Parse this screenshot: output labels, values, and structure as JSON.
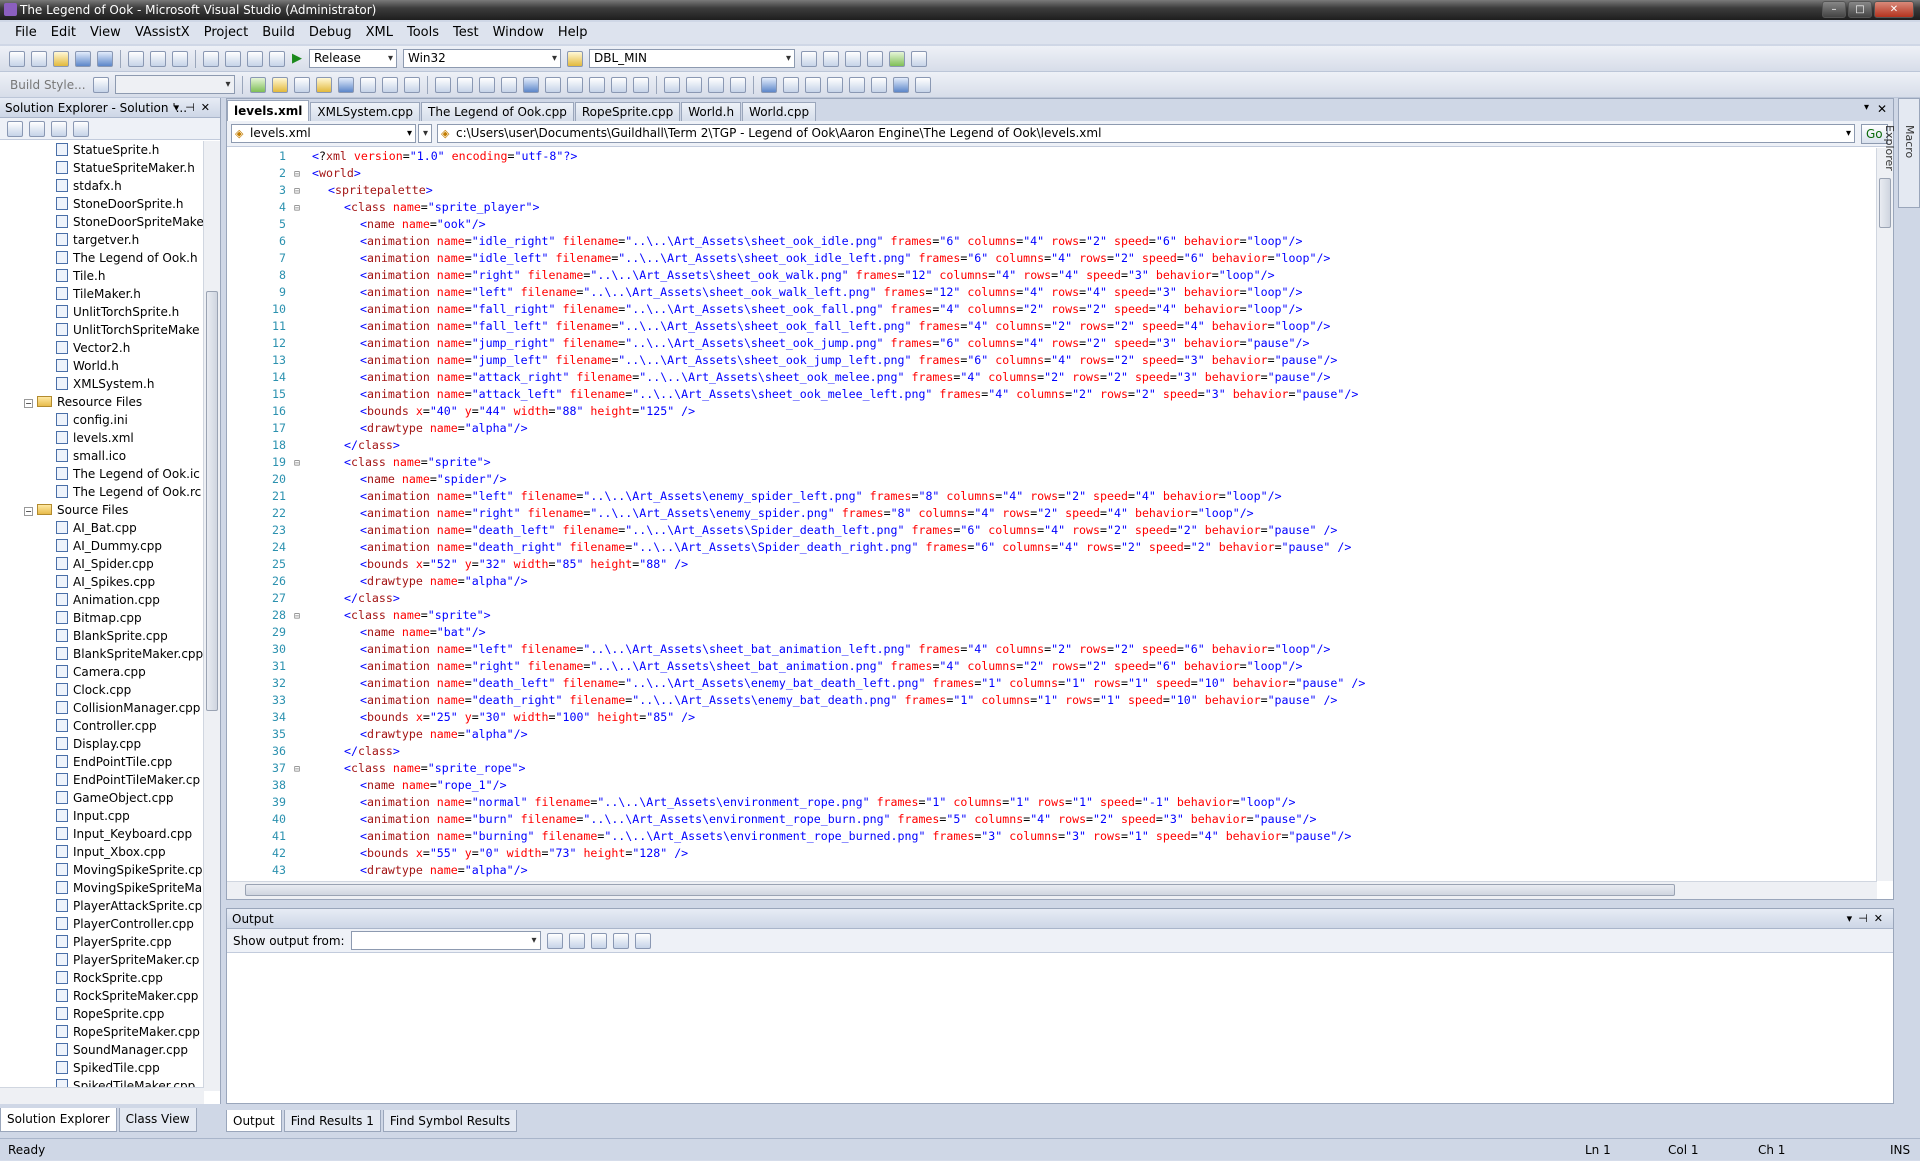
{
  "window": {
    "title": "The Legend of Ook - Microsoft Visual Studio (Administrator)"
  },
  "menu": [
    "File",
    "Edit",
    "View",
    "VAssistX",
    "Project",
    "Build",
    "Debug",
    "XML",
    "Tools",
    "Test",
    "Window",
    "Help"
  ],
  "toolbar": {
    "config": "Release",
    "platform": "Win32",
    "find_combo": "DBL_MIN",
    "build_style": "Build Style..."
  },
  "solution_explorer": {
    "title": "Solution Explorer - Solution '...",
    "items": [
      {
        "indent": 3,
        "type": "file",
        "label": "StatueSprite.h"
      },
      {
        "indent": 3,
        "type": "file",
        "label": "StatueSpriteMaker.h"
      },
      {
        "indent": 3,
        "type": "file",
        "label": "stdafx.h"
      },
      {
        "indent": 3,
        "type": "file",
        "label": "StoneDoorSprite.h"
      },
      {
        "indent": 3,
        "type": "file",
        "label": "StoneDoorSpriteMake"
      },
      {
        "indent": 3,
        "type": "file",
        "label": "targetver.h"
      },
      {
        "indent": 3,
        "type": "file",
        "label": "The Legend of Ook.h"
      },
      {
        "indent": 3,
        "type": "file",
        "label": "Tile.h"
      },
      {
        "indent": 3,
        "type": "file",
        "label": "TileMaker.h"
      },
      {
        "indent": 3,
        "type": "file",
        "label": "UnlitTorchSprite.h"
      },
      {
        "indent": 3,
        "type": "file",
        "label": "UnlitTorchSpriteMake"
      },
      {
        "indent": 3,
        "type": "file",
        "label": "Vector2.h"
      },
      {
        "indent": 3,
        "type": "file",
        "label": "World.h"
      },
      {
        "indent": 3,
        "type": "file",
        "label": "XMLSystem.h"
      },
      {
        "indent": 2,
        "type": "folder",
        "label": "Resource Files"
      },
      {
        "indent": 3,
        "type": "file",
        "label": "config.ini"
      },
      {
        "indent": 3,
        "type": "file",
        "label": "levels.xml"
      },
      {
        "indent": 3,
        "type": "file",
        "label": "small.ico"
      },
      {
        "indent": 3,
        "type": "file",
        "label": "The Legend of Ook.ic"
      },
      {
        "indent": 3,
        "type": "file",
        "label": "The Legend of Ook.rc"
      },
      {
        "indent": 2,
        "type": "folder",
        "label": "Source Files"
      },
      {
        "indent": 3,
        "type": "file",
        "label": "AI_Bat.cpp"
      },
      {
        "indent": 3,
        "type": "file",
        "label": "AI_Dummy.cpp"
      },
      {
        "indent": 3,
        "type": "file",
        "label": "AI_Spider.cpp"
      },
      {
        "indent": 3,
        "type": "file",
        "label": "AI_Spikes.cpp"
      },
      {
        "indent": 3,
        "type": "file",
        "label": "Animation.cpp"
      },
      {
        "indent": 3,
        "type": "file",
        "label": "Bitmap.cpp"
      },
      {
        "indent": 3,
        "type": "file",
        "label": "BlankSprite.cpp"
      },
      {
        "indent": 3,
        "type": "file",
        "label": "BlankSpriteMaker.cpp"
      },
      {
        "indent": 3,
        "type": "file",
        "label": "Camera.cpp"
      },
      {
        "indent": 3,
        "type": "file",
        "label": "Clock.cpp"
      },
      {
        "indent": 3,
        "type": "file",
        "label": "CollisionManager.cpp"
      },
      {
        "indent": 3,
        "type": "file",
        "label": "Controller.cpp"
      },
      {
        "indent": 3,
        "type": "file",
        "label": "Display.cpp"
      },
      {
        "indent": 3,
        "type": "file",
        "label": "EndPointTile.cpp"
      },
      {
        "indent": 3,
        "type": "file",
        "label": "EndPointTileMaker.cp"
      },
      {
        "indent": 3,
        "type": "file",
        "label": "GameObject.cpp"
      },
      {
        "indent": 3,
        "type": "file",
        "label": "Input.cpp"
      },
      {
        "indent": 3,
        "type": "file",
        "label": "Input_Keyboard.cpp"
      },
      {
        "indent": 3,
        "type": "file",
        "label": "Input_Xbox.cpp"
      },
      {
        "indent": 3,
        "type": "file",
        "label": "MovingSpikeSprite.cp"
      },
      {
        "indent": 3,
        "type": "file",
        "label": "MovingSpikeSpriteMa"
      },
      {
        "indent": 3,
        "type": "file",
        "label": "PlayerAttackSprite.cp"
      },
      {
        "indent": 3,
        "type": "file",
        "label": "PlayerController.cpp"
      },
      {
        "indent": 3,
        "type": "file",
        "label": "PlayerSprite.cpp"
      },
      {
        "indent": 3,
        "type": "file",
        "label": "PlayerSpriteMaker.cp"
      },
      {
        "indent": 3,
        "type": "file",
        "label": "RockSprite.cpp"
      },
      {
        "indent": 3,
        "type": "file",
        "label": "RockSpriteMaker.cpp"
      },
      {
        "indent": 3,
        "type": "file",
        "label": "RopeSprite.cpp"
      },
      {
        "indent": 3,
        "type": "file",
        "label": "RopeSpriteMaker.cpp"
      },
      {
        "indent": 3,
        "type": "file",
        "label": "SoundManager.cpp"
      },
      {
        "indent": 3,
        "type": "file",
        "label": "SpikedTile.cpp"
      },
      {
        "indent": 3,
        "type": "file",
        "label": "SpikedTileMaker.cpp"
      }
    ],
    "bottom_tabs": [
      "Solution Explorer",
      "Class View"
    ]
  },
  "editor": {
    "tabs": [
      "levels.xml",
      "XMLSystem.cpp",
      "The Legend of Ook.cpp",
      "RopeSprite.cpp",
      "World.h",
      "World.cpp"
    ],
    "nav_left": "levels.xml",
    "nav_path": "c:\\Users\\user\\Documents\\Guildhall\\Term 2\\TGP - Legend of Ook\\Aaron Engine\\The Legend of Ook\\levels.xml",
    "go_label": "Go",
    "lines": [
      {
        "n": 1,
        "ind": 0,
        "t": "<?xml version=\"1.0\" encoding=\"utf-8\"?>"
      },
      {
        "n": 2,
        "ind": 0,
        "t": "<world>",
        "fold": 1
      },
      {
        "n": 3,
        "ind": 1,
        "t": "<spritepalette>",
        "fold": 1
      },
      {
        "n": 4,
        "ind": 2,
        "t": "<class name=\"sprite_player\">",
        "fold": 1
      },
      {
        "n": 5,
        "ind": 3,
        "t": "<name name=\"ook\"/>"
      },
      {
        "n": 6,
        "ind": 3,
        "t": "<animation name=\"idle_right\" filename=\"..\\..\\Art_Assets\\sheet_ook_idle.png\" frames=\"6\" columns=\"4\" rows=\"2\" speed=\"6\" behavior=\"loop\"/>"
      },
      {
        "n": 7,
        "ind": 3,
        "t": "<animation name=\"idle_left\" filename=\"..\\..\\Art_Assets\\sheet_ook_idle_left.png\" frames=\"6\" columns=\"4\" rows=\"2\" speed=\"6\" behavior=\"loop\"/>"
      },
      {
        "n": 8,
        "ind": 3,
        "t": "<animation name=\"right\" filename=\"..\\..\\Art_Assets\\sheet_ook_walk.png\" frames=\"12\" columns=\"4\" rows=\"4\" speed=\"3\" behavior=\"loop\"/>"
      },
      {
        "n": 9,
        "ind": 3,
        "t": "<animation name=\"left\" filename=\"..\\..\\Art_Assets\\sheet_ook_walk_left.png\" frames=\"12\" columns=\"4\" rows=\"4\" speed=\"3\" behavior=\"loop\"/>"
      },
      {
        "n": 10,
        "ind": 3,
        "t": "<animation name=\"fall_right\" filename=\"..\\..\\Art_Assets\\sheet_ook_fall.png\" frames=\"4\" columns=\"2\" rows=\"2\" speed=\"4\" behavior=\"loop\"/>"
      },
      {
        "n": 11,
        "ind": 3,
        "t": "<animation name=\"fall_left\" filename=\"..\\..\\Art_Assets\\sheet_ook_fall_left.png\" frames=\"4\" columns=\"2\" rows=\"2\" speed=\"4\" behavior=\"loop\"/>"
      },
      {
        "n": 12,
        "ind": 3,
        "t": "<animation name=\"jump_right\" filename=\"..\\..\\Art_Assets\\sheet_ook_jump.png\" frames=\"6\" columns=\"4\" rows=\"2\" speed=\"3\" behavior=\"pause\"/>"
      },
      {
        "n": 13,
        "ind": 3,
        "t": "<animation name=\"jump_left\" filename=\"..\\..\\Art_Assets\\sheet_ook_jump_left.png\" frames=\"6\" columns=\"4\" rows=\"2\" speed=\"3\" behavior=\"pause\"/>"
      },
      {
        "n": 14,
        "ind": 3,
        "t": "<animation name=\"attack_right\" filename=\"..\\..\\Art_Assets\\sheet_ook_melee.png\" frames=\"4\" columns=\"2\" rows=\"2\" speed=\"3\" behavior=\"pause\"/>"
      },
      {
        "n": 15,
        "ind": 3,
        "t": "<animation name=\"attack_left\" filename=\"..\\..\\Art_Assets\\sheet_ook_melee_left.png\" frames=\"4\" columns=\"2\" rows=\"2\" speed=\"3\" behavior=\"pause\"/>"
      },
      {
        "n": 16,
        "ind": 3,
        "t": "<bounds x=\"40\" y=\"44\" width=\"88\" height=\"125\" />"
      },
      {
        "n": 17,
        "ind": 3,
        "t": "<drawtype name=\"alpha\"/>"
      },
      {
        "n": 18,
        "ind": 2,
        "t": "</class>"
      },
      {
        "n": 19,
        "ind": 2,
        "t": "<class name=\"sprite\">",
        "fold": 1
      },
      {
        "n": 20,
        "ind": 3,
        "t": "<name name=\"spider\"/>"
      },
      {
        "n": 21,
        "ind": 3,
        "t": "<animation name=\"left\" filename=\"..\\..\\Art_Assets\\enemy_spider_left.png\" frames=\"8\" columns=\"4\" rows=\"2\" speed=\"4\" behavior=\"loop\"/>"
      },
      {
        "n": 22,
        "ind": 3,
        "t": "<animation name=\"right\" filename=\"..\\..\\Art_Assets\\enemy_spider.png\" frames=\"8\" columns=\"4\" rows=\"2\" speed=\"4\" behavior=\"loop\"/>"
      },
      {
        "n": 23,
        "ind": 3,
        "t": "<animation name=\"death_left\" filename=\"..\\..\\Art_Assets\\Spider_death_left.png\" frames=\"6\" columns=\"4\" rows=\"2\" speed=\"2\" behavior=\"pause\" />"
      },
      {
        "n": 24,
        "ind": 3,
        "t": "<animation name=\"death_right\" filename=\"..\\..\\Art_Assets\\Spider_death_right.png\" frames=\"6\" columns=\"4\" rows=\"2\" speed=\"2\" behavior=\"pause\" />"
      },
      {
        "n": 25,
        "ind": 3,
        "t": "<bounds x=\"52\" y=\"32\" width=\"85\" height=\"88\" />"
      },
      {
        "n": 26,
        "ind": 3,
        "t": "<drawtype name=\"alpha\"/>"
      },
      {
        "n": 27,
        "ind": 2,
        "t": "</class>"
      },
      {
        "n": 28,
        "ind": 2,
        "t": "<class name=\"sprite\">",
        "fold": 1
      },
      {
        "n": 29,
        "ind": 3,
        "t": "<name name=\"bat\"/>"
      },
      {
        "n": 30,
        "ind": 3,
        "t": "<animation name=\"left\" filename=\"..\\..\\Art_Assets\\sheet_bat_animation_left.png\" frames=\"4\" columns=\"2\" rows=\"2\" speed=\"6\" behavior=\"loop\"/>"
      },
      {
        "n": 31,
        "ind": 3,
        "t": "<animation name=\"right\" filename=\"..\\..\\Art_Assets\\sheet_bat_animation.png\" frames=\"4\" columns=\"2\" rows=\"2\" speed=\"6\" behavior=\"loop\"/>"
      },
      {
        "n": 32,
        "ind": 3,
        "t": "<animation name=\"death_left\" filename=\"..\\..\\Art_Assets\\enemy_bat_death_left.png\" frames=\"1\" columns=\"1\" rows=\"1\" speed=\"10\" behavior=\"pause\" />"
      },
      {
        "n": 33,
        "ind": 3,
        "t": "<animation name=\"death_right\" filename=\"..\\..\\Art_Assets\\enemy_bat_death.png\" frames=\"1\" columns=\"1\" rows=\"1\" speed=\"10\" behavior=\"pause\" />"
      },
      {
        "n": 34,
        "ind": 3,
        "t": "<bounds x=\"25\" y=\"30\" width=\"100\" height=\"85\" />"
      },
      {
        "n": 35,
        "ind": 3,
        "t": "<drawtype name=\"alpha\"/>"
      },
      {
        "n": 36,
        "ind": 2,
        "t": "</class>"
      },
      {
        "n": 37,
        "ind": 2,
        "t": "<class name=\"sprite_rope\">",
        "fold": 1
      },
      {
        "n": 38,
        "ind": 3,
        "t": "<name name=\"rope_1\"/>"
      },
      {
        "n": 39,
        "ind": 3,
        "t": "<animation name=\"normal\" filename=\"..\\..\\Art_Assets\\environment_rope.png\" frames=\"1\" columns=\"1\" rows=\"1\" speed=\"-1\" behavior=\"loop\"/>"
      },
      {
        "n": 40,
        "ind": 3,
        "t": "<animation name=\"burn\" filename=\"..\\..\\Art_Assets\\environment_rope_burn.png\" frames=\"5\" columns=\"4\" rows=\"2\" speed=\"3\" behavior=\"pause\"/>"
      },
      {
        "n": 41,
        "ind": 3,
        "t": "<animation name=\"burning\" filename=\"..\\..\\Art_Assets\\environment_rope_burned.png\" frames=\"3\" columns=\"3\" rows=\"1\" speed=\"4\" behavior=\"pause\"/>"
      },
      {
        "n": 42,
        "ind": 3,
        "t": "<bounds x=\"55\" y=\"0\" width=\"73\" height=\"128\" />"
      },
      {
        "n": 43,
        "ind": 3,
        "t": "<drawtype name=\"alpha\"/>"
      }
    ]
  },
  "output": {
    "title": "Output",
    "show_from_label": "Show output from:",
    "tabs": [
      "Output",
      "Find Results 1",
      "Find Symbol Results"
    ]
  },
  "macro_explorer": "Macro Explorer",
  "status": {
    "ready": "Ready",
    "ln": "Ln 1",
    "col": "Col 1",
    "ch": "Ch 1",
    "ins": "INS"
  }
}
